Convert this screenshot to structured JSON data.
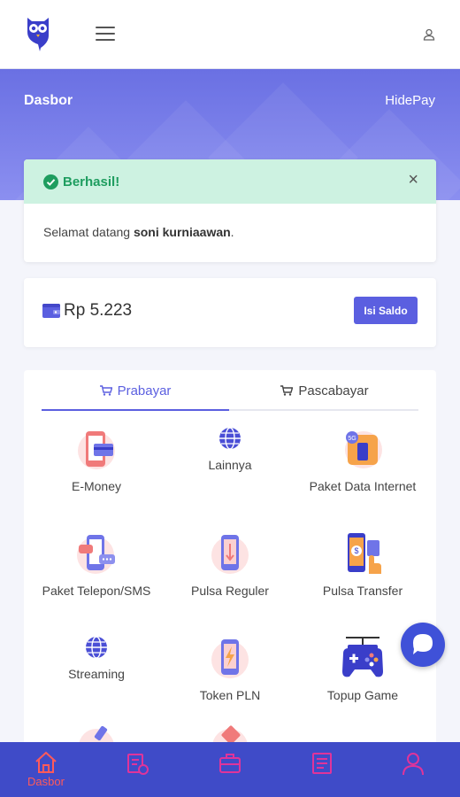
{
  "header": {
    "logo": "owl-logo-icon",
    "menu_icon": "hamburger-icon",
    "user_icon": "user-icon"
  },
  "hero": {
    "title": "Dasbor",
    "brand": "HidePay"
  },
  "alert": {
    "title": "Berhasil!",
    "message_prefix": "Selamat datang ",
    "username": "soni kurniaawan",
    "message_suffix": ".",
    "close": "×"
  },
  "balance": {
    "amount": "Rp 5.223",
    "topup_label": "Isi Saldo"
  },
  "tabs": [
    {
      "label": "Prabayar",
      "active": true
    },
    {
      "label": "Pascabayar",
      "active": false
    }
  ],
  "services": [
    {
      "label": "E-Money",
      "icon": "emoney-icon"
    },
    {
      "label": "Lainnya",
      "icon": "globe-icon"
    },
    {
      "label": "Paket Data Internet",
      "icon": "data-package-icon"
    },
    {
      "label": "Paket Telepon/SMS",
      "icon": "phone-sms-icon"
    },
    {
      "label": "Pulsa Reguler",
      "icon": "pulsa-icon"
    },
    {
      "label": "Pulsa Transfer",
      "icon": "pulsa-transfer-icon"
    },
    {
      "label": "Streaming",
      "icon": "globe-icon"
    },
    {
      "label": "Token PLN",
      "icon": "token-pln-icon"
    },
    {
      "label": "Topup Game",
      "icon": "gamepad-icon"
    }
  ],
  "bottom_nav": [
    {
      "label": "Dasbor",
      "icon": "home-icon",
      "active": true
    },
    {
      "label": "",
      "icon": "transaction-icon"
    },
    {
      "label": "",
      "icon": "briefcase-icon"
    },
    {
      "label": "",
      "icon": "document-icon"
    },
    {
      "label": "",
      "icon": "profile-icon"
    }
  ],
  "colors": {
    "primary": "#5b5fe0",
    "nav_bg": "#3f4bc8",
    "success": "#1e9d5f",
    "nav_accent": "#ff5a5a"
  }
}
